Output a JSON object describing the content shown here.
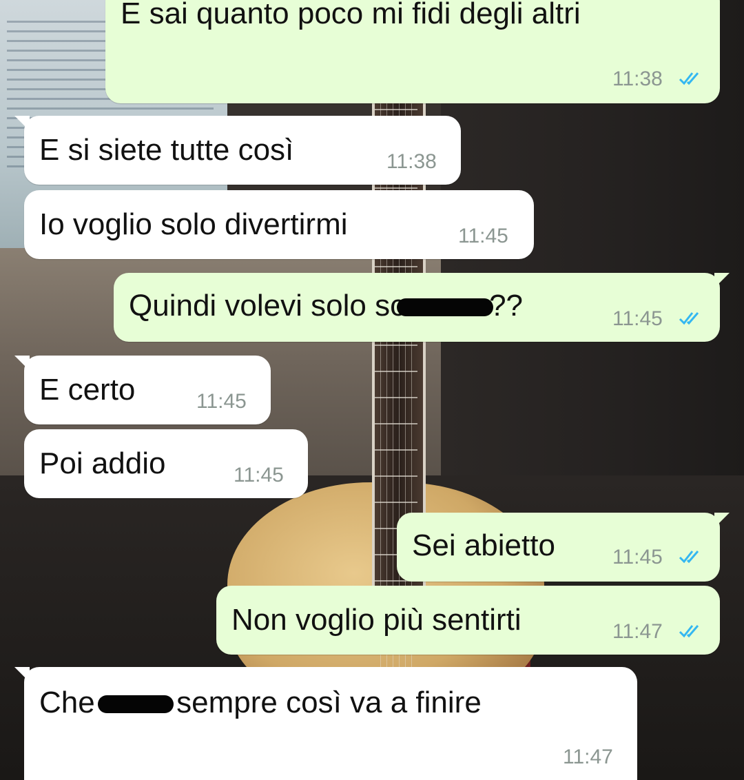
{
  "colors": {
    "incoming_bubble": "#ffffff",
    "outgoing_bubble": "#e7fed6",
    "timestamp": "#8b9691",
    "read_ticks": "#34b7f1"
  },
  "messages": [
    {
      "direction": "outgoing",
      "text": "E sai quanto poco mi fidi degli altri",
      "time": "11:38",
      "status": "read"
    },
    {
      "direction": "incoming",
      "text": "E si siete tutte così",
      "time": "11:38"
    },
    {
      "direction": "incoming",
      "text": "Io voglio solo divertirmi",
      "time": "11:45"
    },
    {
      "direction": "outgoing",
      "text_before": "Quindi volevi solo sc",
      "redacted": true,
      "text_after": "??",
      "time": "11:45",
      "status": "read"
    },
    {
      "direction": "incoming",
      "text": "E certo",
      "time": "11:45"
    },
    {
      "direction": "incoming",
      "text": "Poi addio",
      "time": "11:45"
    },
    {
      "direction": "outgoing",
      "text": "Sei abietto",
      "time": "11:45",
      "status": "read"
    },
    {
      "direction": "outgoing",
      "text": "Non voglio più sentirti",
      "time": "11:47",
      "status": "read"
    },
    {
      "direction": "incoming",
      "text_before": "Che ",
      "redacted": true,
      "text_after": " sempre così va a finire",
      "time": "11:47"
    }
  ]
}
